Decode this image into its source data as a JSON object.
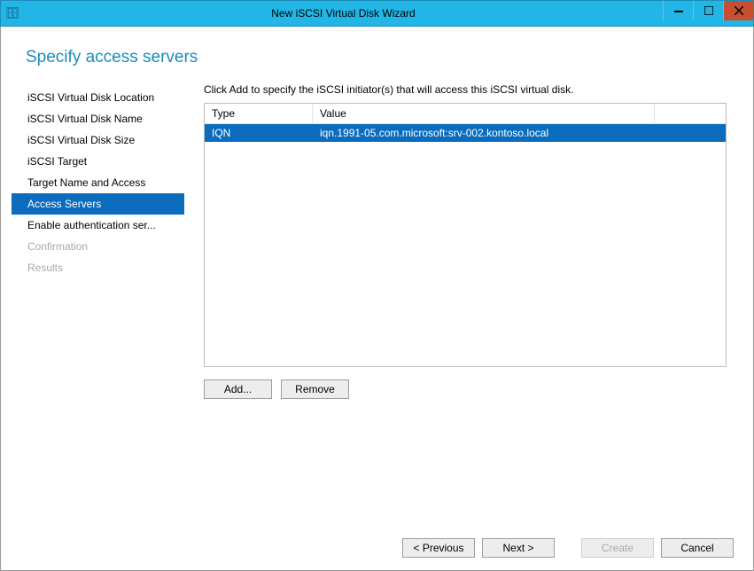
{
  "titlebar": {
    "title": "New iSCSI Virtual Disk Wizard"
  },
  "page": {
    "title": "Specify access servers"
  },
  "sidebar": {
    "items": [
      {
        "label": "iSCSI Virtual Disk Location",
        "state": "normal"
      },
      {
        "label": "iSCSI Virtual Disk Name",
        "state": "normal"
      },
      {
        "label": "iSCSI Virtual Disk Size",
        "state": "normal"
      },
      {
        "label": "iSCSI Target",
        "state": "normal"
      },
      {
        "label": "Target Name and Access",
        "state": "normal"
      },
      {
        "label": "Access Servers",
        "state": "active"
      },
      {
        "label": "Enable authentication ser...",
        "state": "normal"
      },
      {
        "label": "Confirmation",
        "state": "disabled"
      },
      {
        "label": "Results",
        "state": "disabled"
      }
    ]
  },
  "main": {
    "instruction": "Click Add to specify the iSCSI initiator(s) that will access this iSCSI virtual disk.",
    "table": {
      "headers": {
        "type": "Type",
        "value": "Value"
      },
      "rows": [
        {
          "type": "IQN",
          "value": "iqn.1991-05.com.microsoft:srv-002.kontoso.local"
        }
      ]
    },
    "buttons": {
      "add": "Add...",
      "remove": "Remove"
    }
  },
  "footer": {
    "previous": "< Previous",
    "next": "Next >",
    "create": "Create",
    "cancel": "Cancel"
  }
}
